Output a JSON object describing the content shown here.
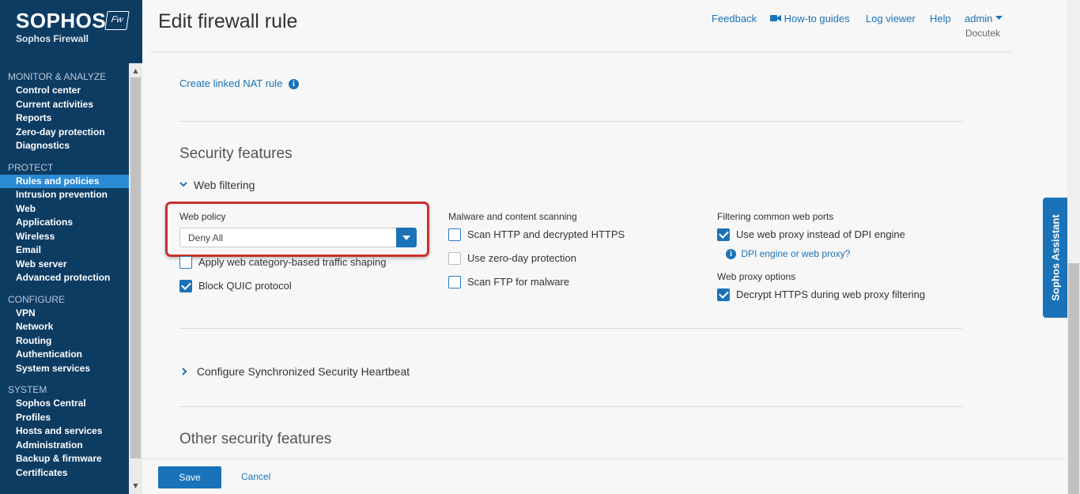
{
  "brand": {
    "name": "SOPHOS",
    "badge": "Fw",
    "product": "Sophos Firewall"
  },
  "nav": [
    {
      "section": "MONITOR & ANALYZE",
      "items": [
        "Control center",
        "Current activities",
        "Reports",
        "Zero-day protection",
        "Diagnostics"
      ]
    },
    {
      "section": "PROTECT",
      "items": [
        "Rules and policies",
        "Intrusion prevention",
        "Web",
        "Applications",
        "Wireless",
        "Email",
        "Web server",
        "Advanced protection"
      ]
    },
    {
      "section": "CONFIGURE",
      "items": [
        "VPN",
        "Network",
        "Routing",
        "Authentication",
        "System services"
      ]
    },
    {
      "section": "SYSTEM",
      "items": [
        "Sophos Central",
        "Profiles",
        "Hosts and services",
        "Administration",
        "Backup & firmware",
        "Certificates"
      ]
    }
  ],
  "active_nav_item": "Rules and policies",
  "header": {
    "title": "Edit firewall rule",
    "links": {
      "feedback": "Feedback",
      "howto": "How-to guides",
      "logviewer": "Log viewer",
      "help": "Help",
      "admin": "admin"
    },
    "company": "Docutek"
  },
  "nat_link": "Create linked NAT rule",
  "security": {
    "title": "Security features",
    "web_filtering": "Web filtering",
    "web_policy_label": "Web policy",
    "web_policy_value": "Deny All",
    "left": [
      {
        "label": "Apply web category-based traffic shaping",
        "checked": false
      },
      {
        "label": "Block QUIC protocol",
        "checked": true
      }
    ],
    "malware_title": "Malware and content scanning",
    "malware": [
      {
        "label": "Scan HTTP and decrypted HTTPS",
        "checked": false
      },
      {
        "label": "Use zero-day protection",
        "checked": false,
        "disabled": true
      },
      {
        "label": "Scan FTP for malware",
        "checked": false
      }
    ],
    "ports_title": "Filtering common web ports",
    "ports_option": {
      "label": "Use web proxy instead of DPI engine",
      "checked": true
    },
    "dpi_link": "DPI engine or web proxy?",
    "proxy_title": "Web proxy options",
    "proxy_option": {
      "label": "Decrypt HTTPS during web proxy filtering",
      "checked": true
    },
    "heartbeat": "Configure Synchronized Security Heartbeat",
    "other_title": "Other security features"
  },
  "footer": {
    "save": "Save",
    "cancel": "Cancel"
  },
  "assistant": "Sophos Assistant",
  "colors": {
    "sidebar": "#0d3c63",
    "accent": "#1a73b8",
    "active_nav": "#2a8ad4",
    "highlight": "#c9302c"
  }
}
